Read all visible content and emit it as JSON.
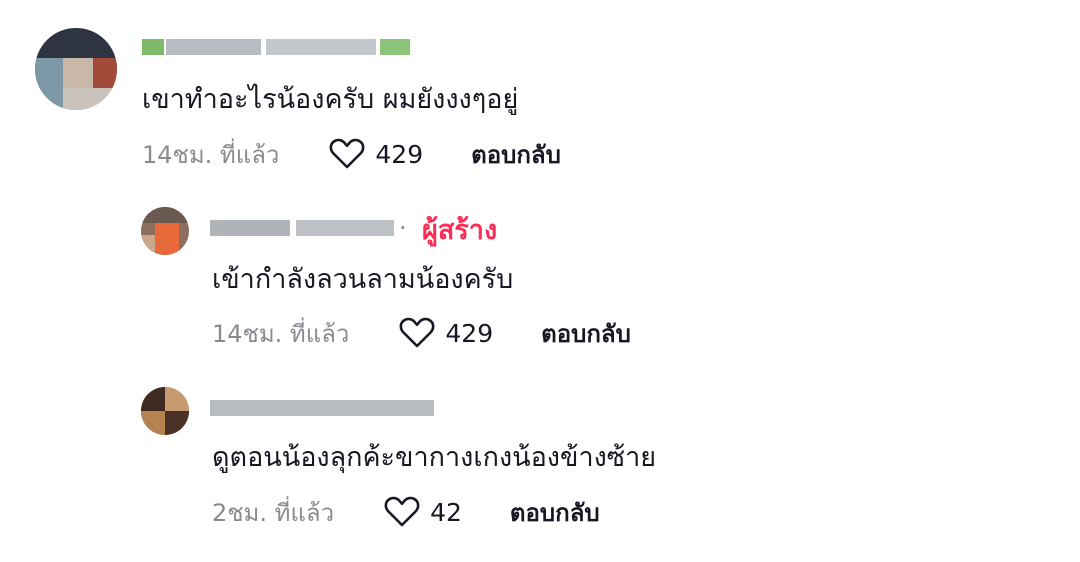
{
  "comments": [
    {
      "text": "เขาทำอะไรน้องครับ ผมยังงงๆอยู่",
      "time": "14ชม. ที่แล้ว",
      "likes": "429",
      "reply_label": "ตอบกลับ"
    },
    {
      "creator_label": "ผู้สร้าง",
      "text": "เข้ากำลังลวนลามน้องครับ",
      "time": "14ชม. ที่แล้ว",
      "likes": "429",
      "reply_label": "ตอบกลับ"
    },
    {
      "text": "ดูตอนน้องลุกค้ะขากางเกงน้องข้างซ้าย",
      "time": "2ชม. ที่แล้ว",
      "likes": "42",
      "reply_label": "ตอบกลับ"
    }
  ],
  "icons": {
    "like": "heart-outline-icon"
  },
  "colors": {
    "creator": "#fe2c55",
    "secondary_text": "#8a8b91",
    "primary_text": "#161823"
  }
}
